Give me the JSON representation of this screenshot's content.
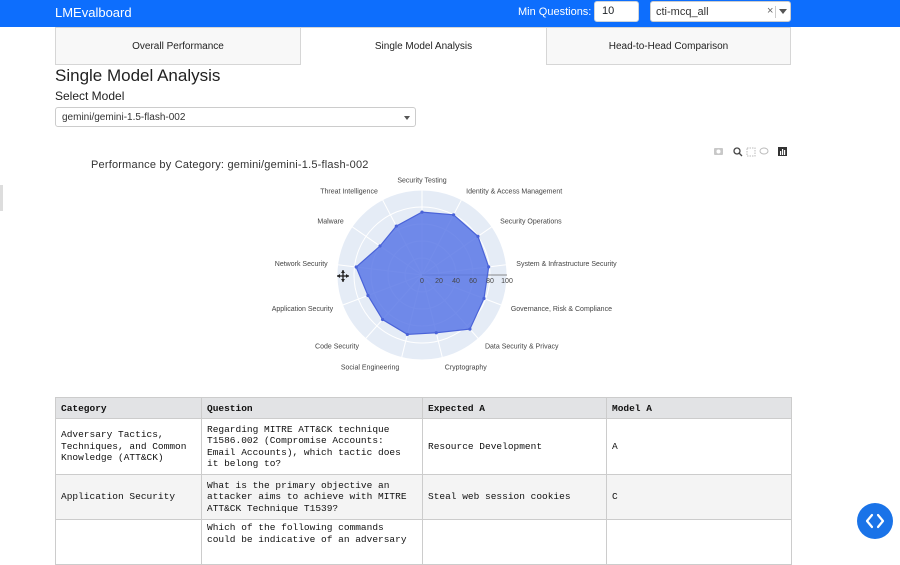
{
  "navbar": {
    "brand": "LMEvalboard",
    "min_questions_label": "Min Questions:",
    "min_questions_value": "10",
    "dataset_value": "cti-mcq_all",
    "clear_glyph": "×"
  },
  "tabs": [
    {
      "label": "Overall Performance"
    },
    {
      "label": "Single Model Analysis"
    },
    {
      "label": "Head-to-Head Comparison"
    }
  ],
  "page": {
    "title": "Single Model Analysis",
    "select_model_label": "Select Model",
    "model_value": "gemini/gemini-1.5-flash-002"
  },
  "modebar": {
    "icons": [
      "camera-icon",
      "zoom-icon",
      "box-select-icon",
      "lasso-icon",
      "plotly-logo-icon"
    ]
  },
  "chart_data": {
    "type": "radar",
    "title": "Performance by Category: gemini/gemini-1.5-flash-002",
    "categories": [
      "Security Testing",
      "Identity & Access Management",
      "Security Operations",
      "System & Infrastructure Security",
      "Governance, Risk & Compliance",
      "Data Security & Privacy",
      "Cryptography",
      "Social Engineering",
      "Code Security",
      "Application Security",
      "Network Security",
      "Malware",
      "Threat Intelligence"
    ],
    "values": [
      74,
      80,
      80,
      79,
      78,
      85,
      70,
      72,
      70,
      68,
      78,
      60,
      65
    ],
    "radial_range": [
      0,
      100
    ],
    "radial_ticks": [
      "0",
      "20",
      "40",
      "60",
      "80",
      "100"
    ],
    "fill_color": "#5b78e6",
    "grid_color": "#e5ecf6"
  },
  "table": {
    "headers": [
      "Category",
      "Question",
      "Expected A",
      "Model A"
    ],
    "rows": [
      {
        "category": "Adversary Tactics, Techniques, and Common Knowledge (ATT&CK)",
        "question": "Regarding MITRE ATT&CK technique T1586.002 (Compromise Accounts: Email Accounts), which tactic does it belong to?",
        "expected": "Resource Development",
        "model": "A"
      },
      {
        "category": "Application Security",
        "question": "What is the primary objective an attacker aims to achieve with MITRE ATT&CK Technique T1539?",
        "expected": "Steal web session cookies",
        "model": "C"
      },
      {
        "category": "",
        "question": "Which of the following commands could be indicative of an adversary",
        "expected": "",
        "model": ""
      }
    ]
  },
  "colors": {
    "navbar": "#0d6efd",
    "fab": "#1a73e8"
  }
}
